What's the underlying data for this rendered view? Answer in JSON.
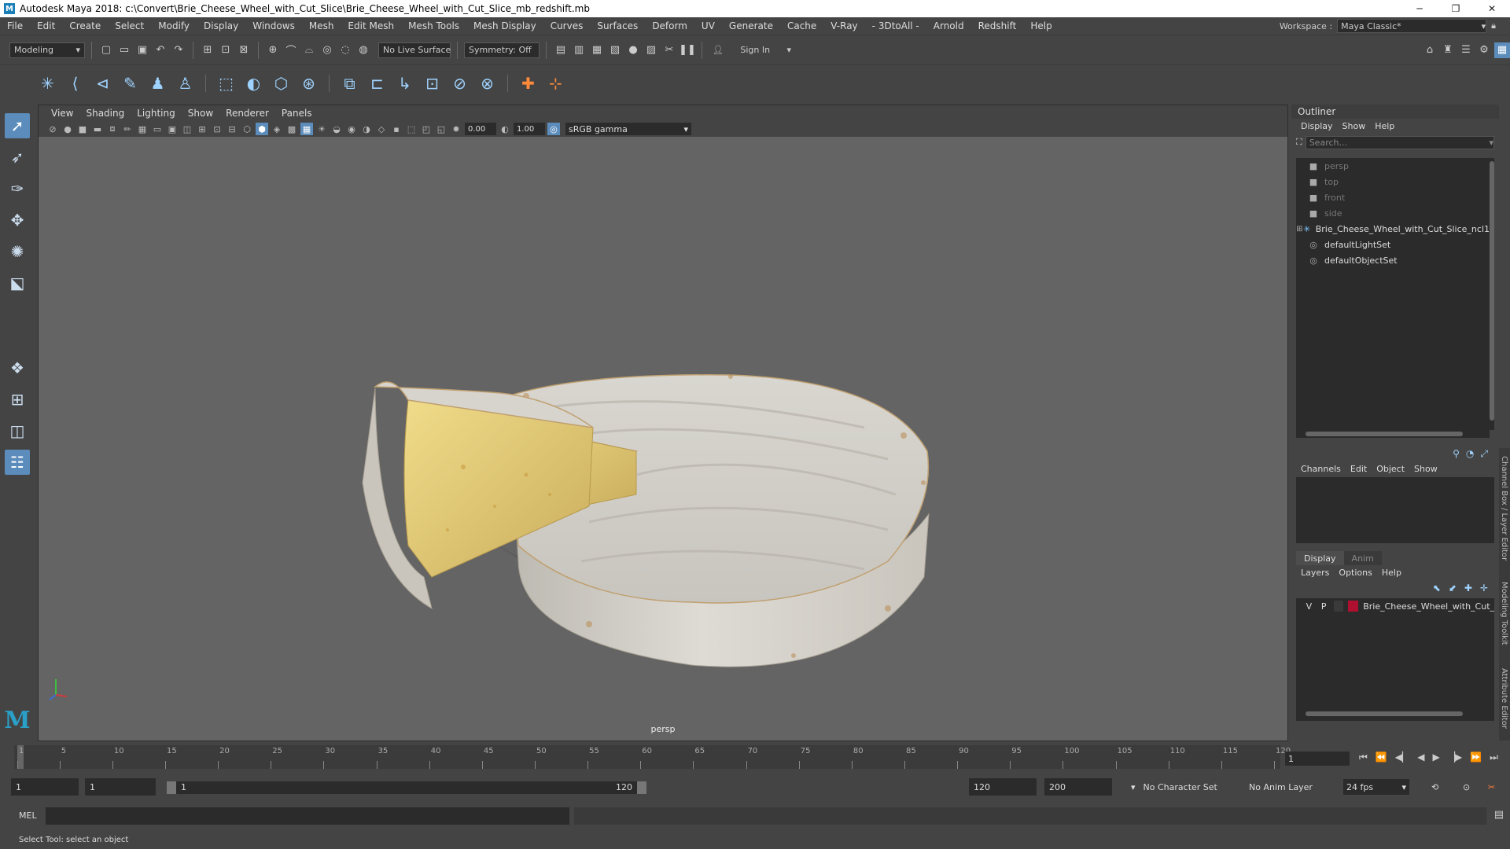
{
  "window": {
    "title": "Autodesk Maya 2018: c:\\Convert\\Brie_Cheese_Wheel_with_Cut_Slice\\Brie_Cheese_Wheel_with_Cut_Slice_mb_redshift.mb",
    "minimize": "─",
    "maximize": "❐",
    "close": "✕"
  },
  "menubar": {
    "items": [
      "File",
      "Edit",
      "Create",
      "Select",
      "Modify",
      "Display",
      "Windows",
      "Mesh",
      "Edit Mesh",
      "Mesh Tools",
      "Mesh Display",
      "Curves",
      "Surfaces",
      "Deform",
      "UV",
      "Generate",
      "Cache",
      "V-Ray",
      "- 3DtoAll -",
      "Arnold",
      "Redshift",
      "Help"
    ],
    "workspace_label": "Workspace :",
    "workspace_value": "Maya Classic*"
  },
  "statusline": {
    "mode": "Modeling",
    "live_surface": "No Live Surface",
    "symmetry": "Symmetry: Off",
    "sign_in": "Sign In"
  },
  "viewport": {
    "menu": [
      "View",
      "Shading",
      "Lighting",
      "Show",
      "Renderer",
      "Panels"
    ],
    "exposure": "0.00",
    "gamma": "1.00",
    "color_space": "sRGB gamma",
    "camera_label": "persp"
  },
  "outliner": {
    "title": "Outliner",
    "menu": [
      "Display",
      "Show",
      "Help"
    ],
    "search_placeholder": "Search...",
    "items": [
      {
        "label": "persp",
        "kind": "camera"
      },
      {
        "label": "top",
        "kind": "camera"
      },
      {
        "label": "front",
        "kind": "camera"
      },
      {
        "label": "side",
        "kind": "camera"
      },
      {
        "label": "Brie_Cheese_Wheel_with_Cut_Slice_ncl1",
        "kind": "mesh"
      },
      {
        "label": "defaultLightSet",
        "kind": "set"
      },
      {
        "label": "defaultObjectSet",
        "kind": "set"
      }
    ]
  },
  "channelbox": {
    "menu": [
      "Channels",
      "Edit",
      "Object",
      "Show"
    ],
    "layer_tabs": [
      "Display",
      "Anim"
    ],
    "layer_menu": [
      "Layers",
      "Options",
      "Help"
    ],
    "layer": {
      "visible": "V",
      "playback": "P",
      "name": "Brie_Cheese_Wheel_with_Cut_",
      "color": "#b01030"
    }
  },
  "side_tabs": [
    "Channel Box / Layer Editor",
    "Modeling Toolkit",
    "Attribute Editor"
  ],
  "timeline": {
    "ticks": [
      "1",
      "5",
      "10",
      "15",
      "20",
      "25",
      "30",
      "35",
      "40",
      "45",
      "50",
      "55",
      "60",
      "65",
      "70",
      "75",
      "80",
      "85",
      "90",
      "95",
      "100",
      "105",
      "110",
      "115",
      "120"
    ],
    "current_frame": "1"
  },
  "range": {
    "start": "1",
    "playback_start": "1",
    "bar_start": "1",
    "bar_end": "120",
    "playback_end": "120",
    "end": "200",
    "character_set": "No Character Set",
    "anim_layer": "No Anim Layer",
    "fps": "24 fps"
  },
  "command": {
    "language": "MEL"
  },
  "helpline": {
    "text": "Select Tool: select an object"
  }
}
